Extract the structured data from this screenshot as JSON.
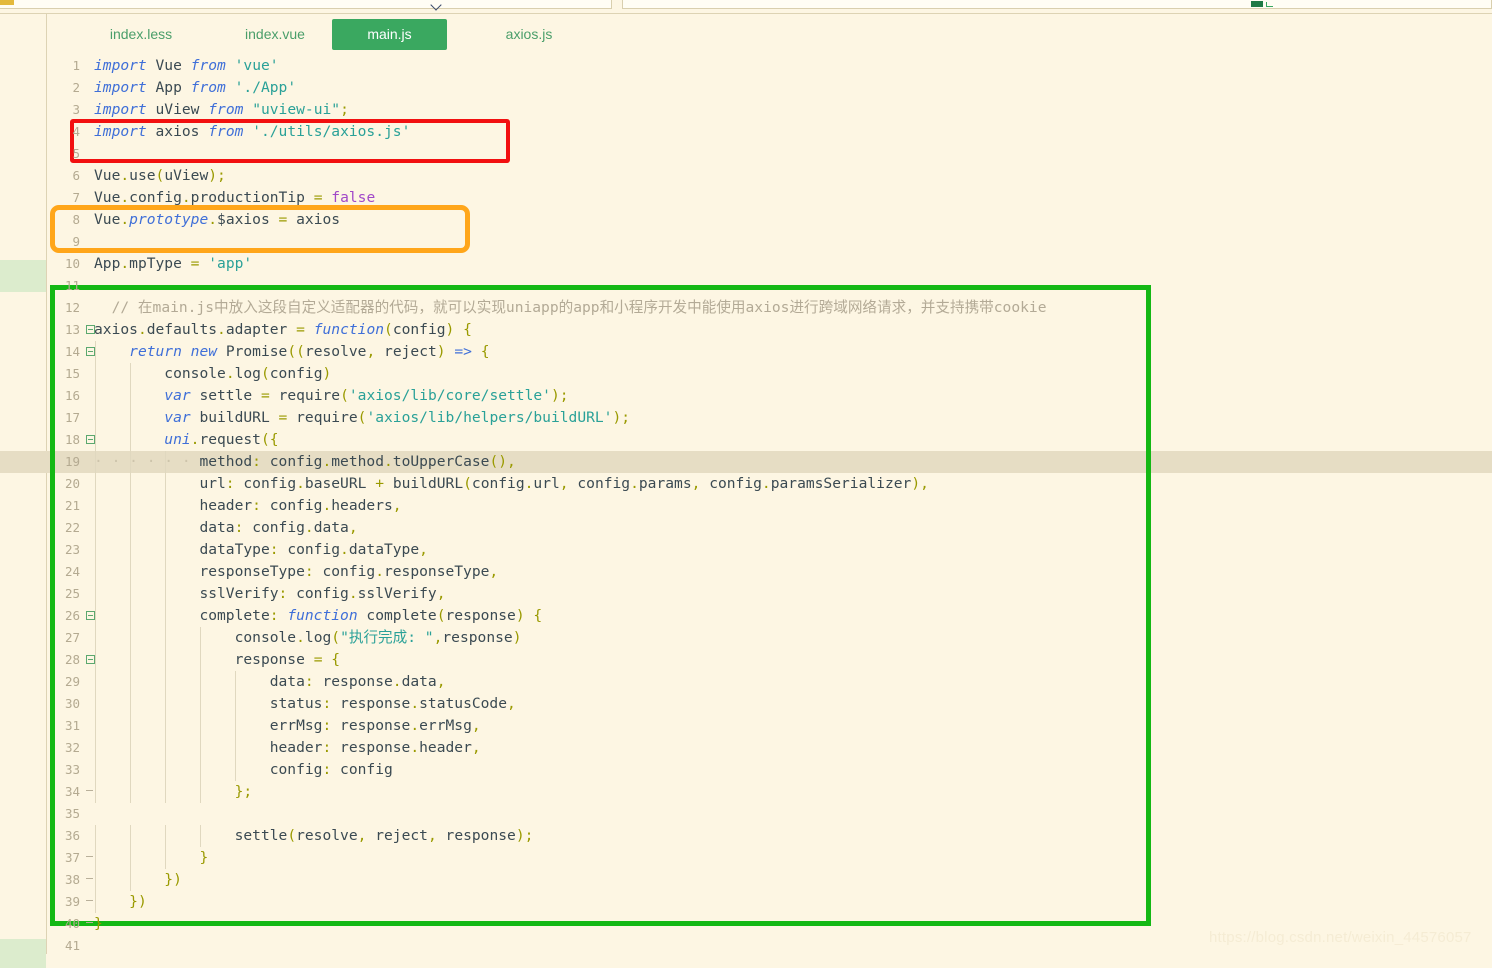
{
  "app": {
    "watermark": "https://blog.csdn.net/weixin_44576057",
    "accent_green": "#3aa860",
    "background": "#fdf6e3"
  },
  "tabs": [
    {
      "label": "index.less",
      "active": false
    },
    {
      "label": "index.vue",
      "active": false
    },
    {
      "label": "main.js",
      "active": true
    },
    {
      "label": "axios.js",
      "active": false
    }
  ],
  "annotations": [
    {
      "name": "red-box",
      "color": "#f21010",
      "targets": "line 4: import axios from './utils/axios.js'"
    },
    {
      "name": "orange-box",
      "color": "#ffa61a",
      "targets": "line 8: Vue.prototype.$axios = axios"
    },
    {
      "name": "green-box",
      "color": "#14b814",
      "targets": "lines 11-39: axios.defaults.adapter custom adapter"
    }
  ],
  "editor": {
    "active_file": "main.js",
    "highlighted_line": 19,
    "first_line": 1,
    "last_line": 41,
    "lines": [
      {
        "n": "1",
        "fold": "",
        "text": "import Vue from 'vue'"
      },
      {
        "n": "2",
        "fold": "",
        "text": "import App from './App'"
      },
      {
        "n": "3",
        "fold": "",
        "text": "import uView from \"uview-ui\";"
      },
      {
        "n": "4",
        "fold": "",
        "text": "import axios from './utils/axios.js'"
      },
      {
        "n": "5",
        "fold": "",
        "text": ""
      },
      {
        "n": "6",
        "fold": "",
        "text": "Vue.use(uView);"
      },
      {
        "n": "7",
        "fold": "",
        "text": "Vue.config.productionTip = false"
      },
      {
        "n": "8",
        "fold": "",
        "text": "Vue.prototype.$axios = axios"
      },
      {
        "n": "9",
        "fold": "",
        "text": ""
      },
      {
        "n": "10",
        "fold": "",
        "text": "App.mpType = 'app'"
      },
      {
        "n": "11",
        "fold": "",
        "text": ""
      },
      {
        "n": "12",
        "fold": "",
        "text": "  // 在main.js中放入这段自定义适配器的代码，就可以实现uniapp的app和小程序开发中能使用axios进行跨域网络请求，并支持携带cookie"
      },
      {
        "n": "13",
        "fold": "open",
        "text": "axios.defaults.adapter = function(config) {"
      },
      {
        "n": "14",
        "fold": "open",
        "text": "    return new Promise((resolve, reject) => {"
      },
      {
        "n": "15",
        "fold": "",
        "text": "        console.log(config)"
      },
      {
        "n": "16",
        "fold": "",
        "text": "        var settle = require('axios/lib/core/settle');"
      },
      {
        "n": "17",
        "fold": "",
        "text": "        var buildURL = require('axios/lib/helpers/buildURL');"
      },
      {
        "n": "18",
        "fold": "open",
        "text": "        uni.request({"
      },
      {
        "n": "19",
        "fold": "",
        "text": "            method: config.method.toUpperCase(),"
      },
      {
        "n": "20",
        "fold": "",
        "text": "            url: config.baseURL + buildURL(config.url, config.params, config.paramsSerializer),"
      },
      {
        "n": "21",
        "fold": "",
        "text": "            header: config.headers,"
      },
      {
        "n": "22",
        "fold": "",
        "text": "            data: config.data,"
      },
      {
        "n": "23",
        "fold": "",
        "text": "            dataType: config.dataType,"
      },
      {
        "n": "24",
        "fold": "",
        "text": "            responseType: config.responseType,"
      },
      {
        "n": "25",
        "fold": "",
        "text": "            sslVerify: config.sslVerify,"
      },
      {
        "n": "26",
        "fold": "open",
        "text": "            complete: function complete(response) {"
      },
      {
        "n": "27",
        "fold": "",
        "text": "                console.log(\"执行完成: \",response)"
      },
      {
        "n": "28",
        "fold": "open",
        "text": "                response = {"
      },
      {
        "n": "29",
        "fold": "",
        "text": "                    data: response.data,"
      },
      {
        "n": "30",
        "fold": "",
        "text": "                    status: response.statusCode,"
      },
      {
        "n": "31",
        "fold": "",
        "text": "                    errMsg: response.errMsg,"
      },
      {
        "n": "32",
        "fold": "",
        "text": "                    header: response.header,"
      },
      {
        "n": "33",
        "fold": "",
        "text": "                    config: config"
      },
      {
        "n": "34",
        "fold": "end",
        "text": "                };"
      },
      {
        "n": "35",
        "fold": "",
        "text": ""
      },
      {
        "n": "36",
        "fold": "",
        "text": "                settle(resolve, reject, response);"
      },
      {
        "n": "37",
        "fold": "end",
        "text": "            }"
      },
      {
        "n": "38",
        "fold": "end",
        "text": "        })"
      },
      {
        "n": "39",
        "fold": "end",
        "text": "    })"
      },
      {
        "n": "40",
        "fold": "end",
        "text": "}"
      },
      {
        "n": "41",
        "fold": "",
        "text": ""
      }
    ]
  }
}
